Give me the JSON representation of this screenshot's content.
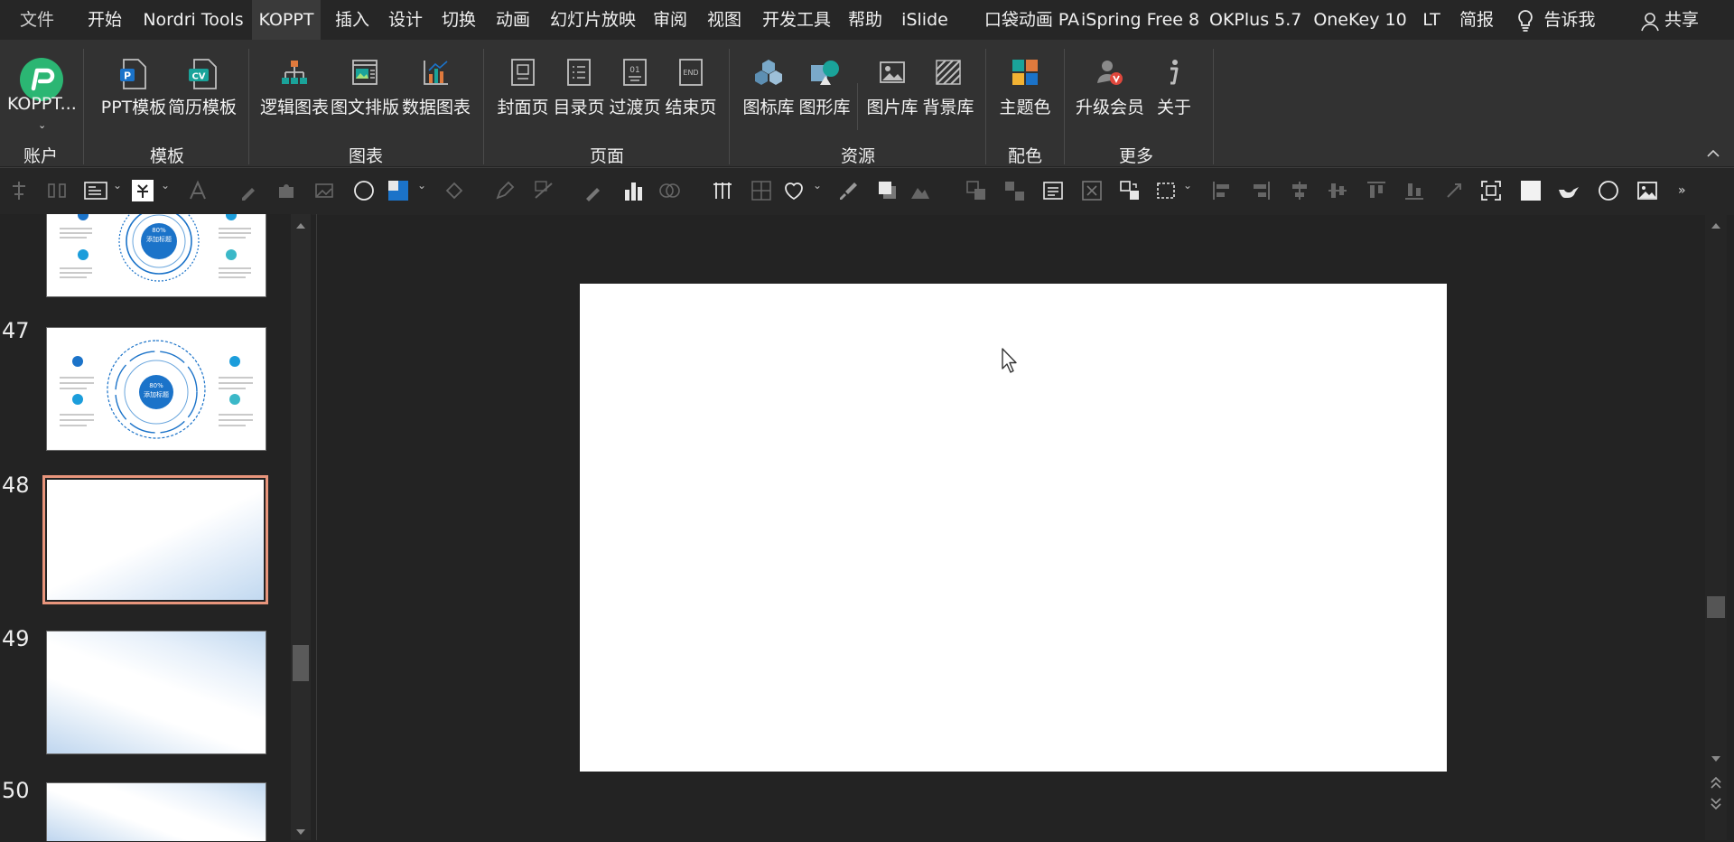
{
  "menu": {
    "tabs": [
      "文件",
      "开始",
      "Nordri Tools",
      "KOPPT",
      "插入",
      "设计",
      "切换",
      "动画",
      "幻灯片放映",
      "审阅",
      "视图",
      "开发工具",
      "帮助",
      "iSlide",
      "口袋动画 PA",
      "iSpring Free 8",
      "OKPlus 5.7",
      "OneKey 10",
      "LT",
      "简报"
    ],
    "tell_me": "告诉我",
    "share": "共享"
  },
  "ribbon": {
    "account_btn": "KOPPT...",
    "ppt_template": "PPT模板",
    "cv_template": "简历模板",
    "logic_chart": "逻辑图表",
    "image_layout": "图文排版",
    "data_chart": "数据图表",
    "cover_page": "封面页",
    "toc_page": "目录页",
    "transition_page": "过渡页",
    "end_page": "结束页",
    "icon_lib": "图标库",
    "shape_lib": "图形库",
    "image_lib": "图片库",
    "bg_lib": "背景库",
    "theme_color": "主题色",
    "upgrade": "升级会员",
    "about": "关于",
    "icon_text": {
      "p": "P",
      "cv": "CV",
      "page_num": "01",
      "end": "END"
    },
    "groups": {
      "account": "账户",
      "template": "模板",
      "chart": "图表",
      "page": "页面",
      "resource": "资源",
      "color": "配色",
      "more": "更多"
    }
  },
  "slides": {
    "numbers": [
      "47",
      "48",
      "49",
      "50"
    ],
    "selected": "48",
    "thumb_text": {
      "pct": "80%",
      "title": "添加标题",
      "subtitle": "添加标题"
    }
  },
  "colors": {
    "accent_green": "#2bb673",
    "selection_border": "#e8957c",
    "thumb_blue": "#1b73c9"
  }
}
